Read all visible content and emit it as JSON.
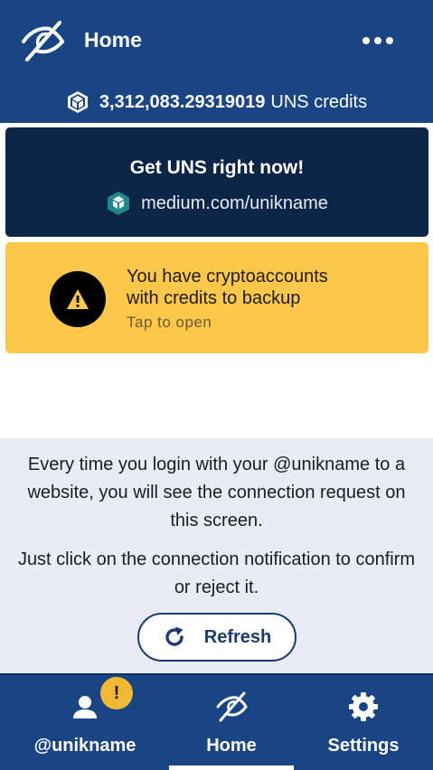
{
  "header": {
    "title": "Home",
    "logo_icon": "eye-slash-logo-icon",
    "menu_icon": "more-dots-icon"
  },
  "balance": {
    "amount": "3,312,083.29319019",
    "unit": "UNS credits",
    "icon": "uns-cube-icon"
  },
  "promo": {
    "title": "Get UNS right now!",
    "link_text": "medium.com/unikname",
    "icon": "medium-hex-icon"
  },
  "alert": {
    "line1": "You have cryptoaccounts",
    "line2": "with credits to backup",
    "subtext": "Tap to open",
    "icon": "warning-icon"
  },
  "info": {
    "paragraph1": "Every time you login with your @unikname to a website, you will see the connection request on this screen.",
    "paragraph2": "Just click on the connection notification to confirm or reject it.",
    "refresh_label": "Refresh"
  },
  "navbar": {
    "items": [
      {
        "label": "@unikname",
        "icon": "user-icon",
        "badge": "!"
      },
      {
        "label": "Home",
        "icon": "eye-slash-icon",
        "active": true
      },
      {
        "label": "Settings",
        "icon": "gear-icon"
      }
    ]
  },
  "colors": {
    "header_bg": "#1a4585",
    "promo_bg": "#0d2547",
    "alert_bg": "#fdc84a",
    "info_bg": "#e9ecf6",
    "badge_bg": "#f1b833",
    "accent_dark": "#1a3b71"
  }
}
